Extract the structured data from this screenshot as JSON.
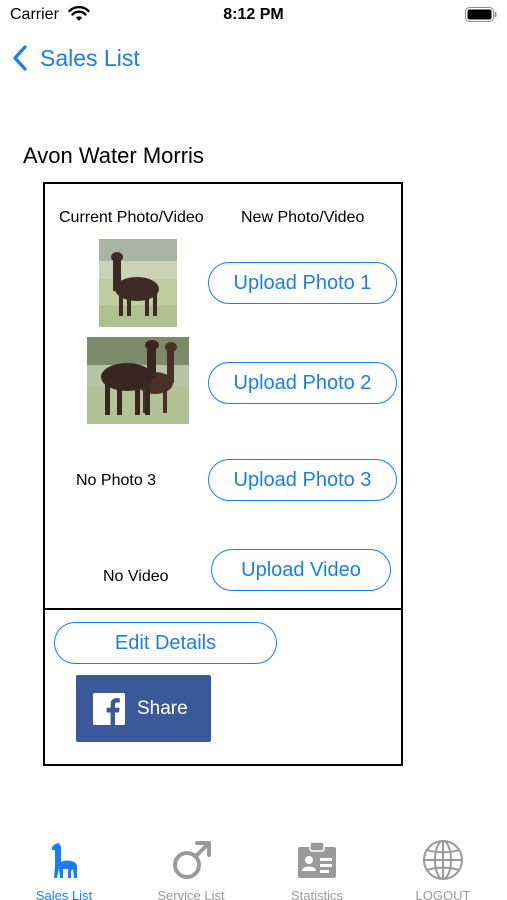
{
  "status_bar": {
    "carrier": "Carrier",
    "time": "8:12 PM"
  },
  "nav": {
    "back_label": "Sales List"
  },
  "page": {
    "title": "Avon Water Morris"
  },
  "card": {
    "col_current": "Current Photo/Video",
    "col_new": "New Photo/Video",
    "upload_photo_1": "Upload Photo 1",
    "upload_photo_2": "Upload Photo 2",
    "upload_photo_3": "Upload Photo 3",
    "upload_video": "Upload Video",
    "no_photo_3": "No Photo 3",
    "no_video": "No Video",
    "edit_details": "Edit Details",
    "share": "Share"
  },
  "tabs": [
    {
      "label": "Sales List",
      "icon": "alpaca-icon",
      "active": true
    },
    {
      "label": "Service List",
      "icon": "male-symbol-icon",
      "active": false
    },
    {
      "label": "Statistics",
      "icon": "id-badge-icon",
      "active": false
    },
    {
      "label": "LOGOUT",
      "icon": "globe-icon",
      "active": false
    }
  ],
  "colors": {
    "accent": "#1a7df0",
    "facebook": "#3b5998",
    "inactive": "#9a9a9a"
  }
}
